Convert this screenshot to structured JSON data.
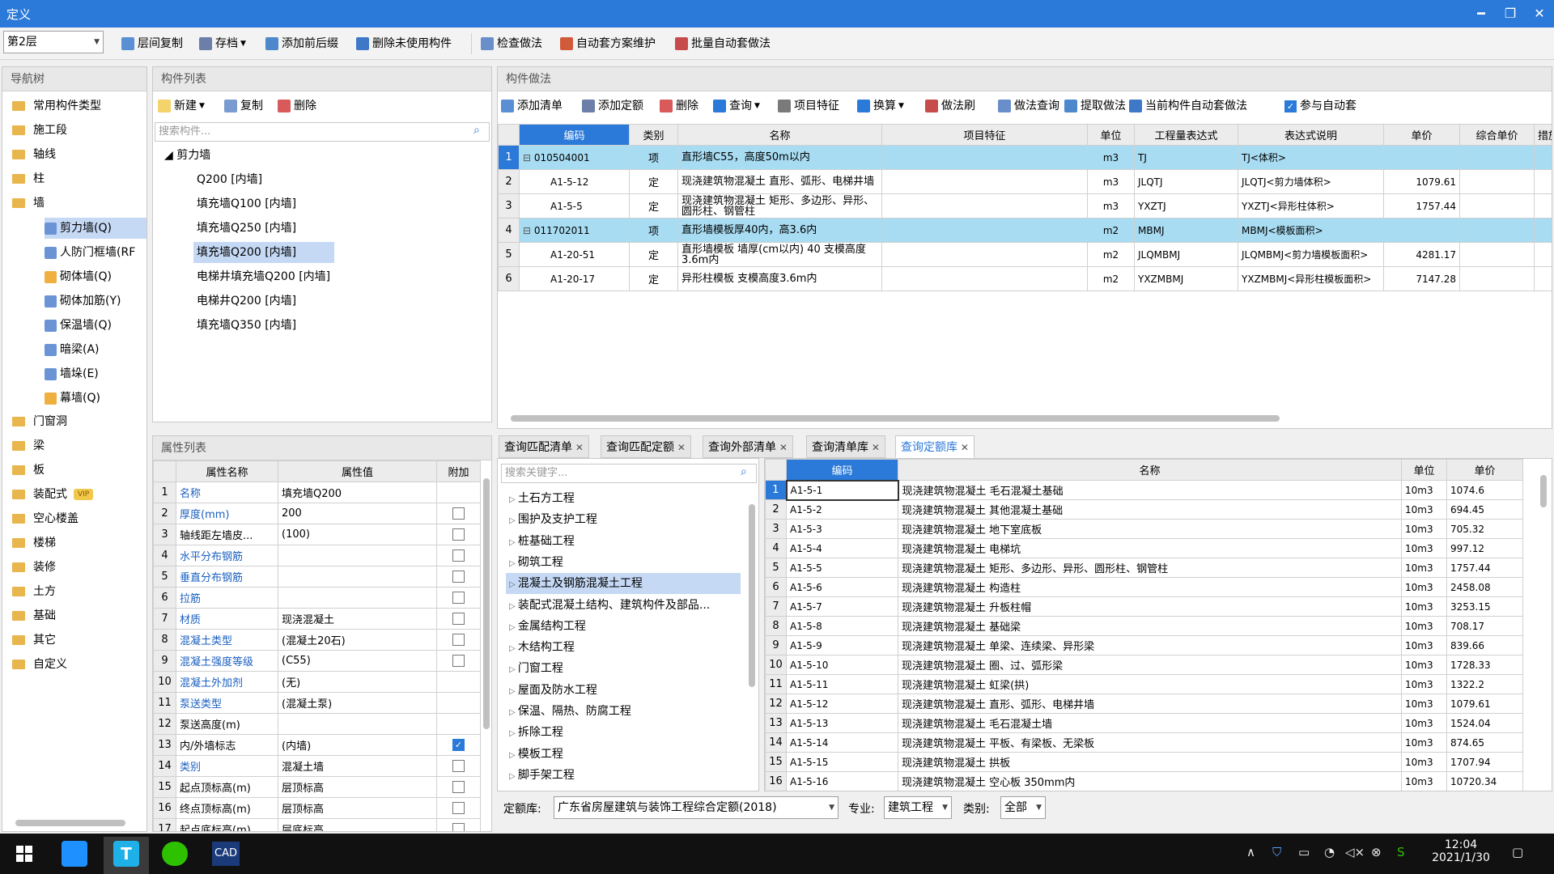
{
  "window": {
    "title": "定义",
    "minimize": "━",
    "restore": "❐",
    "close": "✕"
  },
  "toolbar": {
    "floor": "第2层",
    "buttons": [
      "层间复制",
      "存档",
      "添加前后缀",
      "删除未使用构件",
      "检查做法",
      "自动套方案维护",
      "批量自动套做法"
    ]
  },
  "nav": {
    "title": "导航树",
    "items": [
      "常用构件类型",
      "施工段",
      "轴线",
      "柱",
      "墙",
      "门窗洞",
      "梁",
      "板",
      "装配式",
      "空心楼盖",
      "楼梯",
      "装修",
      "土方",
      "基础",
      "其它",
      "自定义"
    ],
    "vip": "VIP",
    "wall_children": [
      "剪力墙(Q)",
      "人防门框墙(RF",
      "砌体墙(Q)",
      "砌体加筋(Y)",
      "保温墙(Q)",
      "暗梁(A)",
      "墙垛(E)",
      "幕墙(Q)"
    ]
  },
  "component_list": {
    "title": "构件列表",
    "new": "新建",
    "copy": "复制",
    "delete": "删除",
    "search_placeholder": "搜索构件...",
    "root": "剪力墙",
    "items": [
      "Q200 [内墙]",
      "填充墙Q100 [内墙]",
      "填充墙Q250 [内墙]",
      "填充墙Q200 [内墙]",
      "电梯井填充墙Q200 [内墙]",
      "电梯井Q200 [内墙]",
      "填充墙Q350 [内墙]"
    ]
  },
  "properties": {
    "title": "属性列表",
    "headers": [
      "属性名称",
      "属性值",
      "附加"
    ],
    "rows": [
      {
        "n": "1",
        "name": "名称",
        "value": "填充墙Q200",
        "checked": null,
        "blue": true
      },
      {
        "n": "2",
        "name": "厚度(mm)",
        "value": "200",
        "checked": false,
        "blue": true
      },
      {
        "n": "3",
        "name": "轴线距左墙皮...",
        "value": "(100)",
        "checked": false,
        "blue": false
      },
      {
        "n": "4",
        "name": "水平分布钢筋",
        "value": "",
        "checked": false,
        "blue": true
      },
      {
        "n": "5",
        "name": "垂直分布钢筋",
        "value": "",
        "checked": false,
        "blue": true
      },
      {
        "n": "6",
        "name": "拉筋",
        "value": "",
        "checked": false,
        "blue": true
      },
      {
        "n": "7",
        "name": "材质",
        "value": "现浇混凝土",
        "checked": false,
        "blue": true
      },
      {
        "n": "8",
        "name": "混凝土类型",
        "value": "(混凝土20石)",
        "checked": false,
        "blue": true
      },
      {
        "n": "9",
        "name": "混凝土强度等级",
        "value": "(C55)",
        "checked": false,
        "blue": true
      },
      {
        "n": "10",
        "name": "混凝土外加剂",
        "value": "(无)",
        "checked": null,
        "blue": true
      },
      {
        "n": "11",
        "name": "泵送类型",
        "value": "(混凝土泵)",
        "checked": null,
        "blue": true
      },
      {
        "n": "12",
        "name": "泵送高度(m)",
        "value": "",
        "checked": null,
        "blue": false
      },
      {
        "n": "13",
        "name": "内/外墙标志",
        "value": "(内墙)",
        "checked": true,
        "blue": false
      },
      {
        "n": "14",
        "name": "类别",
        "value": "混凝土墙",
        "checked": false,
        "blue": true
      },
      {
        "n": "15",
        "name": "起点顶标高(m)",
        "value": "层顶标高",
        "checked": false,
        "blue": false
      },
      {
        "n": "16",
        "name": "终点顶标高(m)",
        "value": "层顶标高",
        "checked": false,
        "blue": false
      },
      {
        "n": "17",
        "name": "起点底标高(m)",
        "value": "层底标高",
        "checked": false,
        "blue": false
      }
    ]
  },
  "method": {
    "title": "构件做法",
    "buttons": [
      "添加清单",
      "添加定额",
      "删除",
      "查询",
      "项目特征",
      "换算",
      "做法刷",
      "做法查询",
      "提取做法",
      "当前构件自动套做法",
      "参与自动套"
    ],
    "headers": [
      "编码",
      "类别",
      "名称",
      "项目特征",
      "单位",
      "工程量表达式",
      "表达式说明",
      "单价",
      "综合单价",
      "措施"
    ],
    "rows": [
      {
        "n": "1",
        "code": "010504001",
        "type": "项",
        "name": "直形墙C55，高度50m以内",
        "unit": "m3",
        "expr": "TJ",
        "desc": "TJ<体积>",
        "price": "",
        "hl": true,
        "top": true
      },
      {
        "n": "2",
        "code": "A1-5-12",
        "type": "定",
        "name": "现浇建筑物混凝土 直形、弧形、电梯井墙",
        "unit": "m3",
        "expr": "JLQTJ",
        "desc": "JLQTJ<剪力墙体积>",
        "price": "1079.61",
        "hl": false,
        "top": false
      },
      {
        "n": "3",
        "code": "A1-5-5",
        "type": "定",
        "name": "现浇建筑物混凝土 矩形、多边形、异形、圆形柱、钢管柱",
        "unit": "m3",
        "expr": "YXZTJ",
        "desc": "YXZTJ<异形柱体积>",
        "price": "1757.44",
        "hl": false,
        "top": false
      },
      {
        "n": "4",
        "code": "011702011",
        "type": "项",
        "name": "直形墙模板厚40内，高3.6内",
        "unit": "m2",
        "expr": "MBMJ",
        "desc": "MBMJ<模板面积>",
        "price": "",
        "hl": true,
        "top": true
      },
      {
        "n": "5",
        "code": "A1-20-51",
        "type": "定",
        "name": "直形墙模板 墙厚(cm以内) 40 支模高度3.6m内",
        "unit": "m2",
        "expr": "JLQMBMJ",
        "desc": "JLQMBMJ<剪力墙模板面积>",
        "price": "4281.17",
        "hl": false,
        "top": false
      },
      {
        "n": "6",
        "code": "A1-20-17",
        "type": "定",
        "name": "异形柱模板 支模高度3.6m内",
        "unit": "m2",
        "expr": "YXZMBMJ",
        "desc": "YXZMBMJ<异形柱模板面积>",
        "price": "7147.28",
        "hl": false,
        "top": false
      }
    ]
  },
  "tabs": [
    "查询匹配清单",
    "查询匹配定额",
    "查询外部清单",
    "查询清单库",
    "查询定额库"
  ],
  "library": {
    "search_placeholder": "搜索关键字...",
    "tree": [
      "土石方工程",
      "围护及支护工程",
      "桩基础工程",
      "砌筑工程",
      "混凝土及钢筋混凝土工程",
      "装配式混凝土结构、建筑构件及部品...",
      "金属结构工程",
      "木结构工程",
      "门窗工程",
      "屋面及防水工程",
      "保温、隔热、防腐工程",
      "拆除工程",
      "模板工程",
      "脚手架工程"
    ],
    "headers": [
      "编码",
      "名称",
      "单位",
      "单价"
    ],
    "rows": [
      {
        "n": "1",
        "code": "A1-5-1",
        "name": "现浇建筑物混凝土 毛石混凝土基础",
        "unit": "10m3",
        "price": "1074.6"
      },
      {
        "n": "2",
        "code": "A1-5-2",
        "name": "现浇建筑物混凝土 其他混凝土基础",
        "unit": "10m3",
        "price": "694.45"
      },
      {
        "n": "3",
        "code": "A1-5-3",
        "name": "现浇建筑物混凝土 地下室底板",
        "unit": "10m3",
        "price": "705.32"
      },
      {
        "n": "4",
        "code": "A1-5-4",
        "name": "现浇建筑物混凝土 电梯坑",
        "unit": "10m3",
        "price": "997.12"
      },
      {
        "n": "5",
        "code": "A1-5-5",
        "name": "现浇建筑物混凝土 矩形、多边形、异形、圆形柱、钢管柱",
        "unit": "10m3",
        "price": "1757.44"
      },
      {
        "n": "6",
        "code": "A1-5-6",
        "name": "现浇建筑物混凝土 构造柱",
        "unit": "10m3",
        "price": "2458.08"
      },
      {
        "n": "7",
        "code": "A1-5-7",
        "name": "现浇建筑物混凝土 升板柱帽",
        "unit": "10m3",
        "price": "3253.15"
      },
      {
        "n": "8",
        "code": "A1-5-8",
        "name": "现浇建筑物混凝土 基础梁",
        "unit": "10m3",
        "price": "708.17"
      },
      {
        "n": "9",
        "code": "A1-5-9",
        "name": "现浇建筑物混凝土 单梁、连续梁、异形梁",
        "unit": "10m3",
        "price": "839.66"
      },
      {
        "n": "10",
        "code": "A1-5-10",
        "name": "现浇建筑物混凝土 圈、过、弧形梁",
        "unit": "10m3",
        "price": "1728.33"
      },
      {
        "n": "11",
        "code": "A1-5-11",
        "name": "现浇建筑物混凝土 虹梁(拱)",
        "unit": "10m3",
        "price": "1322.2"
      },
      {
        "n": "12",
        "code": "A1-5-12",
        "name": "现浇建筑物混凝土 直形、弧形、电梯井墙",
        "unit": "10m3",
        "price": "1079.61"
      },
      {
        "n": "13",
        "code": "A1-5-13",
        "name": "现浇建筑物混凝土 毛石混凝土墙",
        "unit": "10m3",
        "price": "1524.04"
      },
      {
        "n": "14",
        "code": "A1-5-14",
        "name": "现浇建筑物混凝土 平板、有梁板、无梁板",
        "unit": "10m3",
        "price": "874.65"
      },
      {
        "n": "15",
        "code": "A1-5-15",
        "name": "现浇建筑物混凝土 拱板",
        "unit": "10m3",
        "price": "1707.94"
      },
      {
        "n": "16",
        "code": "A1-5-16",
        "name": "现浇建筑物混凝土 空心板 350mm内",
        "unit": "10m3",
        "price": "10720.34"
      }
    ],
    "footer": {
      "lib_label": "定额库:",
      "lib_value": "广东省房屋建筑与装饰工程综合定额(2018)",
      "spec_label": "专业:",
      "spec_value": "建筑工程",
      "cat_label": "类别:",
      "cat_value": "全部"
    }
  },
  "taskbar": {
    "time": "12:04",
    "date": "2021/1/30",
    "cad": "CAD"
  },
  "colors": {
    "accent": "#2b79d8",
    "row_highlight": "#a8dcf2",
    "selected": "#c5d9f5"
  }
}
